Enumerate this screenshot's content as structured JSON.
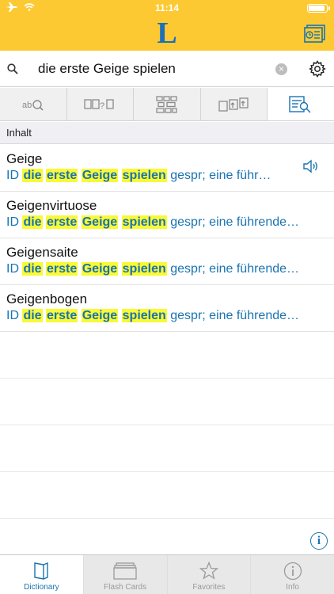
{
  "status_bar": {
    "time": "11:14"
  },
  "header": {
    "logo": "L"
  },
  "search": {
    "value": "die erste Geige spielen",
    "clear_glyph": "×"
  },
  "section": {
    "title": "Inhalt"
  },
  "results": [
    {
      "headword": "Geige",
      "prefix": "ID",
      "highlights": [
        "die",
        "erste",
        "Geige",
        "spielen"
      ],
      "rest": "gespr; eine führ…",
      "has_audio": true
    },
    {
      "headword": "Geigenvirtuose",
      "prefix": "ID",
      "highlights": [
        "die",
        "erste",
        "Geige",
        "spielen"
      ],
      "rest": "gespr; eine führende…",
      "has_audio": false
    },
    {
      "headword": "Geigensaite",
      "prefix": "ID",
      "highlights": [
        "die",
        "erste",
        "Geige",
        "spielen"
      ],
      "rest": "gespr; eine führende…",
      "has_audio": false
    },
    {
      "headword": "Geigenbogen",
      "prefix": "ID",
      "highlights": [
        "die",
        "erste",
        "Geige",
        "spielen"
      ],
      "rest": "gespr; eine führende…",
      "has_audio": false
    }
  ],
  "info_button": {
    "glyph": "i"
  },
  "tabbar": {
    "items": [
      {
        "label": "Dictionary",
        "active": true
      },
      {
        "label": "Flash Cards",
        "active": false
      },
      {
        "label": "Favorites",
        "active": false
      },
      {
        "label": "Info",
        "active": false
      }
    ]
  },
  "colors": {
    "brand_yellow": "#fdc933",
    "brand_blue": "#1a73b0",
    "highlight": "#f9f935"
  }
}
